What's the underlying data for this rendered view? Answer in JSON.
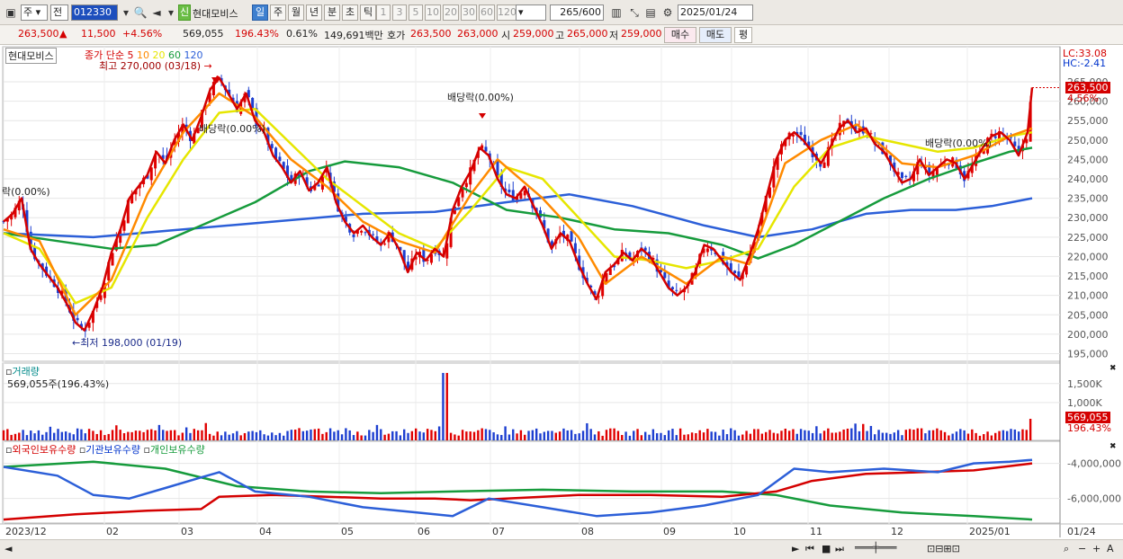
{
  "toolbar": {
    "period_label": "주",
    "prev_label": "전",
    "code_value": "012330",
    "new_badge": "신",
    "stock_name": "현대모비스",
    "period_tabs": [
      "일",
      "주",
      "월",
      "년",
      "분",
      "초",
      "틱"
    ],
    "selected_period": "일",
    "minute_options": [
      "1",
      "3",
      "5",
      "10",
      "20",
      "30",
      "60",
      "120"
    ],
    "count_value": "265",
    "count_max": "/600",
    "date_value": "2025/01/24"
  },
  "quote": {
    "price": "263,500",
    "change": "11,500",
    "change_pct": "+4.56%",
    "volume": "569,055",
    "volume_ratio": "196.43%",
    "turnover_rate": "0.61%",
    "trade_value": "149,691백만",
    "ask_label": "호가",
    "ask": "263,500",
    "bid": "263,000",
    "open_label": "시",
    "open": "259,000",
    "high_label": "고",
    "high": "265,000",
    "low_label": "저",
    "low": "259,000",
    "buy_label": "매수",
    "sell_label": "매도",
    "eval_label": "평"
  },
  "price_panel": {
    "name_tag": "현대모비스",
    "legend_prefix": "종가 단순",
    "ma_periods": [
      "5",
      "10",
      "20",
      "60",
      "120"
    ],
    "ma_colors": [
      "#d40000",
      "#ff8a00",
      "#e6e600",
      "#169b3c",
      "#2c5fd8"
    ],
    "lc_text": "LC:33.08",
    "hc_text": "HC:-2.41",
    "current_price_label": "263,500",
    "current_pct_label": "4.56%",
    "max_annotation": "최고 270,000 (03/18)",
    "min_annotation": "최저 198,000 (01/19)",
    "div_label_1": "배당락(0.00%)",
    "div_label_2": "배당락(0.00%)",
    "div_label_3": "배당락(0.00%)",
    "div_label_4": "락(0.00%)"
  },
  "volume_panel": {
    "title": "거래량",
    "summary": "569,055주(196.43%)",
    "current_value": "569,055",
    "current_pct": "196.43%"
  },
  "holding_panel": {
    "legend": [
      "외국인보유수량",
      "기관보유수량",
      "개인보유수량"
    ],
    "colors": [
      "#d40000",
      "#2c5fd8",
      "#169b3c"
    ]
  },
  "x_axis_labels": [
    "2023/12",
    "02",
    "03",
    "04",
    "05",
    "06",
    "07",
    "08",
    "09",
    "10",
    "11",
    "12",
    "2025/01"
  ],
  "x_axis_right": "01/24",
  "chart_data": {
    "type": "candlestick",
    "x_labels": [
      "2023/12",
      "02",
      "03",
      "04",
      "05",
      "06",
      "07",
      "08",
      "09",
      "10",
      "11",
      "12",
      "2025/01"
    ],
    "price_ticks": [
      265000,
      260000,
      255000,
      250000,
      245000,
      240000,
      235000,
      230000,
      225000,
      220000,
      215000,
      210000,
      205000,
      200000,
      195000
    ],
    "price_tick_labels": [
      "265,000",
      "260,000",
      "255,000",
      "250,000",
      "245,000",
      "240,000",
      "235,000",
      "230,000",
      "225,000",
      "220,000",
      "215,000",
      "210,000",
      "205,000",
      "200,000",
      "195,000"
    ],
    "ylim": [
      193500,
      268000
    ],
    "close_path": [
      [
        0,
        229000
      ],
      [
        10,
        231000
      ],
      [
        20,
        235000
      ],
      [
        30,
        222000
      ],
      [
        40,
        218000
      ],
      [
        50,
        215000
      ],
      [
        60,
        212000
      ],
      [
        70,
        208000
      ],
      [
        80,
        203000
      ],
      [
        90,
        201000
      ],
      [
        100,
        206000
      ],
      [
        110,
        212000
      ],
      [
        120,
        221000
      ],
      [
        130,
        227000
      ],
      [
        140,
        235000
      ],
      [
        150,
        238000
      ],
      [
        160,
        241000
      ],
      [
        170,
        247000
      ],
      [
        180,
        244000
      ],
      [
        190,
        250000
      ],
      [
        200,
        254000
      ],
      [
        210,
        250000
      ],
      [
        220,
        256000
      ],
      [
        230,
        263000
      ],
      [
        240,
        266000
      ],
      [
        250,
        262000
      ],
      [
        260,
        258000
      ],
      [
        270,
        262000
      ],
      [
        280,
        255000
      ],
      [
        290,
        252000
      ],
      [
        300,
        246000
      ],
      [
        310,
        243000
      ],
      [
        320,
        239000
      ],
      [
        330,
        242000
      ],
      [
        340,
        237000
      ],
      [
        350,
        239000
      ],
      [
        360,
        243000
      ],
      [
        370,
        234000
      ],
      [
        380,
        229000
      ],
      [
        390,
        226000
      ],
      [
        400,
        228000
      ],
      [
        410,
        225000
      ],
      [
        420,
        223000
      ],
      [
        430,
        226000
      ],
      [
        440,
        222000
      ],
      [
        450,
        216000
      ],
      [
        460,
        221000
      ],
      [
        470,
        219000
      ],
      [
        480,
        222000
      ],
      [
        490,
        220000
      ],
      [
        500,
        232000
      ],
      [
        510,
        238000
      ],
      [
        520,
        242000
      ],
      [
        530,
        248000
      ],
      [
        540,
        246000
      ],
      [
        550,
        240000
      ],
      [
        560,
        236000
      ],
      [
        570,
        235000
      ],
      [
        580,
        238000
      ],
      [
        590,
        233000
      ],
      [
        600,
        228000
      ],
      [
        610,
        222000
      ],
      [
        620,
        226000
      ],
      [
        630,
        224000
      ],
      [
        640,
        218000
      ],
      [
        650,
        213000
      ],
      [
        660,
        209000
      ],
      [
        670,
        216000
      ],
      [
        680,
        218000
      ],
      [
        690,
        221000
      ],
      [
        700,
        219000
      ],
      [
        710,
        222000
      ],
      [
        720,
        220000
      ],
      [
        730,
        216000
      ],
      [
        740,
        212000
      ],
      [
        750,
        210000
      ],
      [
        760,
        212000
      ],
      [
        770,
        216000
      ],
      [
        780,
        223000
      ],
      [
        790,
        222000
      ],
      [
        800,
        219000
      ],
      [
        810,
        216000
      ],
      [
        820,
        214000
      ],
      [
        830,
        220000
      ],
      [
        840,
        227000
      ],
      [
        850,
        236000
      ],
      [
        860,
        245000
      ],
      [
        870,
        250000
      ],
      [
        880,
        252000
      ],
      [
        890,
        250000
      ],
      [
        900,
        247000
      ],
      [
        910,
        244000
      ],
      [
        920,
        248000
      ],
      [
        930,
        253000
      ],
      [
        940,
        255000
      ],
      [
        950,
        252000
      ],
      [
        960,
        253000
      ],
      [
        970,
        249000
      ],
      [
        980,
        247000
      ],
      [
        990,
        243000
      ],
      [
        1000,
        239000
      ],
      [
        1010,
        240000
      ],
      [
        1020,
        245000
      ],
      [
        1030,
        241000
      ],
      [
        1040,
        243000
      ],
      [
        1050,
        245000
      ],
      [
        1060,
        244000
      ],
      [
        1070,
        240000
      ],
      [
        1080,
        244000
      ],
      [
        1090,
        248000
      ],
      [
        1100,
        251000
      ],
      [
        1110,
        252000
      ],
      [
        1120,
        250000
      ],
      [
        1130,
        246000
      ],
      [
        1140,
        252000
      ],
      [
        1145,
        263500
      ]
    ],
    "ma120_path": [
      [
        0,
        226000
      ],
      [
        100,
        225000
      ],
      [
        200,
        227000
      ],
      [
        300,
        229000
      ],
      [
        400,
        231000
      ],
      [
        480,
        231500
      ],
      [
        560,
        234000
      ],
      [
        630,
        236000
      ],
      [
        700,
        233000
      ],
      [
        780,
        228000
      ],
      [
        840,
        225000
      ],
      [
        900,
        227000
      ],
      [
        960,
        231000
      ],
      [
        1010,
        232000
      ],
      [
        1060,
        232000
      ],
      [
        1100,
        233000
      ],
      [
        1145,
        235000
      ]
    ],
    "ma60_path": [
      [
        0,
        226000
      ],
      [
        60,
        224000
      ],
      [
        120,
        222000
      ],
      [
        170,
        223000
      ],
      [
        220,
        228000
      ],
      [
        280,
        234000
      ],
      [
        340,
        242000
      ],
      [
        380,
        244500
      ],
      [
        440,
        243000
      ],
      [
        500,
        239000
      ],
      [
        560,
        232000
      ],
      [
        620,
        230000
      ],
      [
        680,
        227000
      ],
      [
        740,
        226000
      ],
      [
        800,
        223000
      ],
      [
        840,
        219500
      ],
      [
        880,
        223000
      ],
      [
        930,
        229000
      ],
      [
        980,
        235000
      ],
      [
        1030,
        240000
      ],
      [
        1080,
        244000
      ],
      [
        1120,
        247000
      ],
      [
        1145,
        248000
      ]
    ],
    "ma20_path": [
      [
        0,
        226000
      ],
      [
        40,
        222000
      ],
      [
        80,
        208000
      ],
      [
        120,
        212000
      ],
      [
        160,
        230000
      ],
      [
        200,
        245000
      ],
      [
        240,
        257000
      ],
      [
        280,
        258000
      ],
      [
        320,
        249000
      ],
      [
        360,
        240000
      ],
      [
        400,
        233000
      ],
      [
        440,
        226000
      ],
      [
        480,
        222000
      ],
      [
        520,
        232000
      ],
      [
        560,
        243000
      ],
      [
        600,
        240000
      ],
      [
        640,
        230000
      ],
      [
        680,
        220000
      ],
      [
        720,
        219000
      ],
      [
        760,
        217000
      ],
      [
        800,
        219000
      ],
      [
        840,
        222000
      ],
      [
        880,
        238000
      ],
      [
        920,
        248000
      ],
      [
        960,
        251000
      ],
      [
        1000,
        249000
      ],
      [
        1040,
        247000
      ],
      [
        1080,
        248000
      ],
      [
        1120,
        251000
      ],
      [
        1145,
        252000
      ]
    ],
    "ma10_path": [
      [
        0,
        227000
      ],
      [
        40,
        224000
      ],
      [
        80,
        205000
      ],
      [
        120,
        214000
      ],
      [
        160,
        236000
      ],
      [
        200,
        252000
      ],
      [
        240,
        262000
      ],
      [
        280,
        256000
      ],
      [
        320,
        245000
      ],
      [
        360,
        238000
      ],
      [
        400,
        229000
      ],
      [
        440,
        224000
      ],
      [
        480,
        221000
      ],
      [
        520,
        236000
      ],
      [
        550,
        245000
      ],
      [
        600,
        235000
      ],
      [
        640,
        225000
      ],
      [
        670,
        213000
      ],
      [
        710,
        220000
      ],
      [
        760,
        213000
      ],
      [
        800,
        220000
      ],
      [
        830,
        218000
      ],
      [
        870,
        244000
      ],
      [
        910,
        250000
      ],
      [
        950,
        254000
      ],
      [
        1000,
        244000
      ],
      [
        1040,
        243000
      ],
      [
        1080,
        246000
      ],
      [
        1120,
        251000
      ],
      [
        1145,
        253000
      ]
    ],
    "volume_ticks": [
      "1,500K",
      "1,000K"
    ],
    "volume_scale_max": 1850,
    "volume_spike": {
      "index": 492,
      "value": 1780
    },
    "volume_last": 569,
    "holding_ticks": [
      "-4,000,000",
      "-6,000,000"
    ],
    "holding_ylim": [
      -7400000,
      -3200000
    ],
    "foreign_path": [
      [
        0,
        -7200000
      ],
      [
        80,
        -6900000
      ],
      [
        160,
        -6700000
      ],
      [
        220,
        -6600000
      ],
      [
        240,
        -5900000
      ],
      [
        300,
        -5800000
      ],
      [
        360,
        -5900000
      ],
      [
        420,
        -6000000
      ],
      [
        480,
        -6000000
      ],
      [
        520,
        -6100000
      ],
      [
        560,
        -6000000
      ],
      [
        640,
        -5800000
      ],
      [
        720,
        -5800000
      ],
      [
        800,
        -5900000
      ],
      [
        860,
        -5600000
      ],
      [
        900,
        -5000000
      ],
      [
        960,
        -4600000
      ],
      [
        1020,
        -4500000
      ],
      [
        1080,
        -4400000
      ],
      [
        1145,
        -4000000
      ]
    ],
    "institution_path": [
      [
        0,
        -4200000
      ],
      [
        60,
        -4700000
      ],
      [
        100,
        -5800000
      ],
      [
        140,
        -6000000
      ],
      [
        180,
        -5400000
      ],
      [
        220,
        -4800000
      ],
      [
        240,
        -4500000
      ],
      [
        280,
        -5600000
      ],
      [
        340,
        -5900000
      ],
      [
        400,
        -6500000
      ],
      [
        460,
        -6800000
      ],
      [
        500,
        -7000000
      ],
      [
        540,
        -6000000
      ],
      [
        600,
        -6500000
      ],
      [
        660,
        -7000000
      ],
      [
        720,
        -6800000
      ],
      [
        780,
        -6400000
      ],
      [
        840,
        -5800000
      ],
      [
        880,
        -4300000
      ],
      [
        920,
        -4500000
      ],
      [
        980,
        -4300000
      ],
      [
        1040,
        -4500000
      ],
      [
        1080,
        -4000000
      ],
      [
        1120,
        -3900000
      ],
      [
        1145,
        -3800000
      ]
    ],
    "individual_path": [
      [
        0,
        -4200000
      ],
      [
        100,
        -3900000
      ],
      [
        180,
        -4300000
      ],
      [
        260,
        -5300000
      ],
      [
        340,
        -5600000
      ],
      [
        420,
        -5700000
      ],
      [
        500,
        -5600000
      ],
      [
        600,
        -5500000
      ],
      [
        700,
        -5600000
      ],
      [
        800,
        -5600000
      ],
      [
        860,
        -5800000
      ],
      [
        920,
        -6400000
      ],
      [
        1000,
        -6800000
      ],
      [
        1080,
        -7000000
      ],
      [
        1145,
        -7200000
      ]
    ]
  }
}
